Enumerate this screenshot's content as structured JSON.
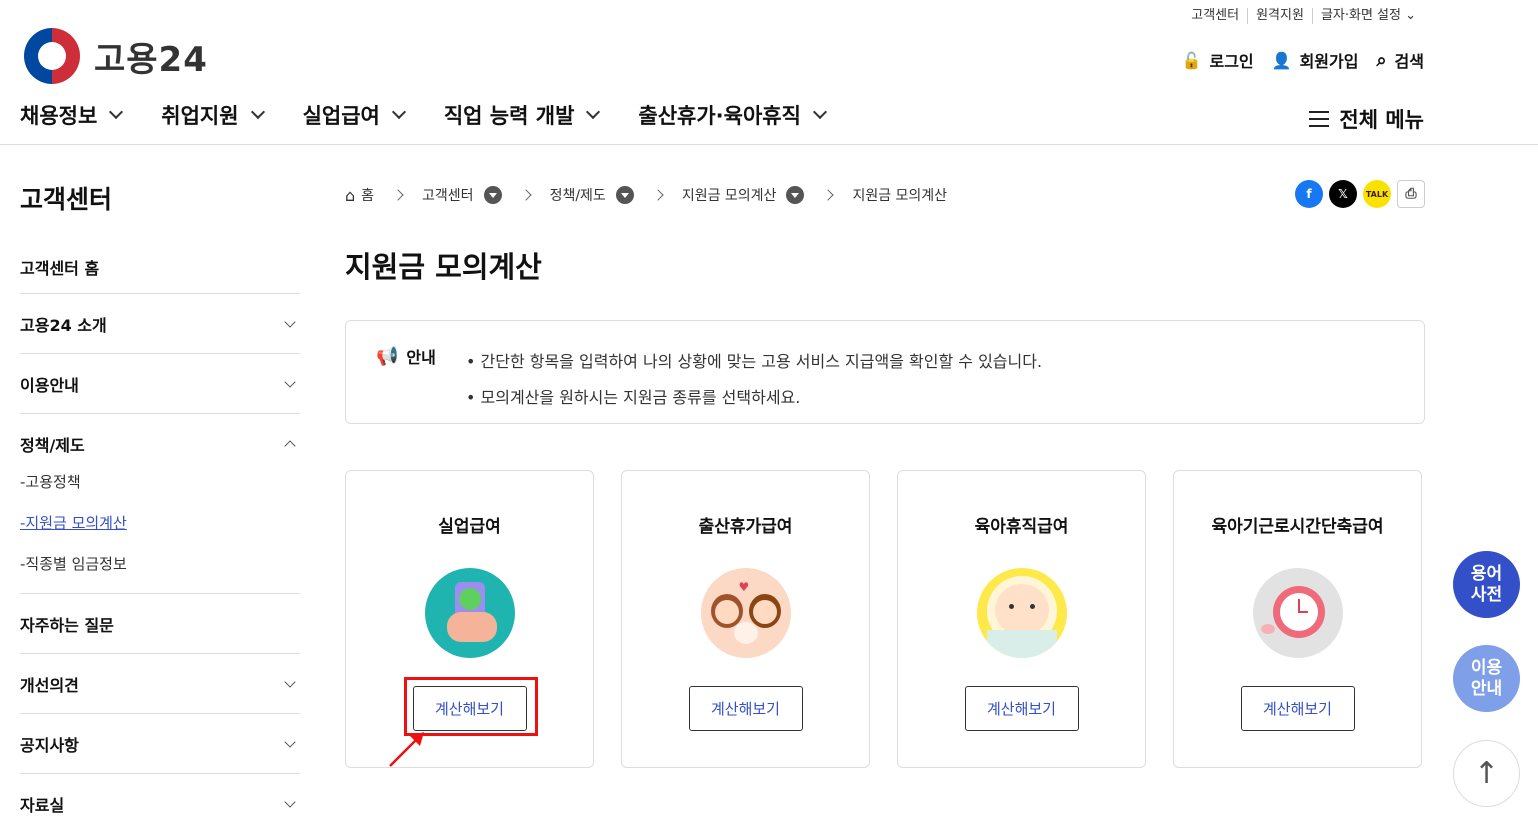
{
  "header": {
    "logo_text": "고용24",
    "util_links": [
      "고객센터",
      "원격지원",
      "글자·화면 설정"
    ],
    "login": "로그인",
    "signup": "회원가입",
    "search": "검색",
    "gnb": [
      "채용정보",
      "취업지원",
      "실업급여",
      "직업 능력 개발",
      "출산휴가·육아휴직"
    ],
    "all_menu": "전체 메뉴"
  },
  "lnb": {
    "title": "고객센터",
    "items": [
      {
        "label": "고객센터 홈"
      },
      {
        "label": "고용24 소개"
      },
      {
        "label": "이용안내"
      },
      {
        "label": "정책/제도"
      },
      {
        "label": "자주하는 질문"
      },
      {
        "label": "개선의견"
      },
      {
        "label": "공지사항"
      },
      {
        "label": "자료실"
      }
    ],
    "subs": [
      "-고용정책",
      "-지원금 모의계산",
      "-직종별 임금정보"
    ]
  },
  "breadcrumb": [
    "홈",
    "고객센터",
    "정책/제도",
    "지원금 모의계산",
    "지원금 모의계산"
  ],
  "page_title": "지원금 모의계산",
  "notice": {
    "label": "안내",
    "lines": [
      "• 간단한 항목을 입력하여 나의 상황에 맞는 고용 서비스 지급액을 확인할 수 있습니다.",
      "• 모의계산을 원하시는 지원금 종류를 선택하세요."
    ]
  },
  "cards": [
    {
      "title": "실업급여",
      "button": "계산해보기",
      "icon": "phone-check-icon"
    },
    {
      "title": "출산휴가급여",
      "button": "계산해보기",
      "icon": "family-icon"
    },
    {
      "title": "육아휴직급여",
      "button": "계산해보기",
      "icon": "baby-icon"
    },
    {
      "title": "육아기근로시간단축급여",
      "button": "계산해보기",
      "icon": "alarm-clock-icon"
    }
  ],
  "fab": {
    "dictionary": "용어\n사전",
    "guide": "이용\n안내"
  },
  "colors": {
    "accent": "#3350c8",
    "highlight": "#e11111",
    "fab_dict": "#3350c8",
    "fab_guide": "#7f9fe8"
  }
}
